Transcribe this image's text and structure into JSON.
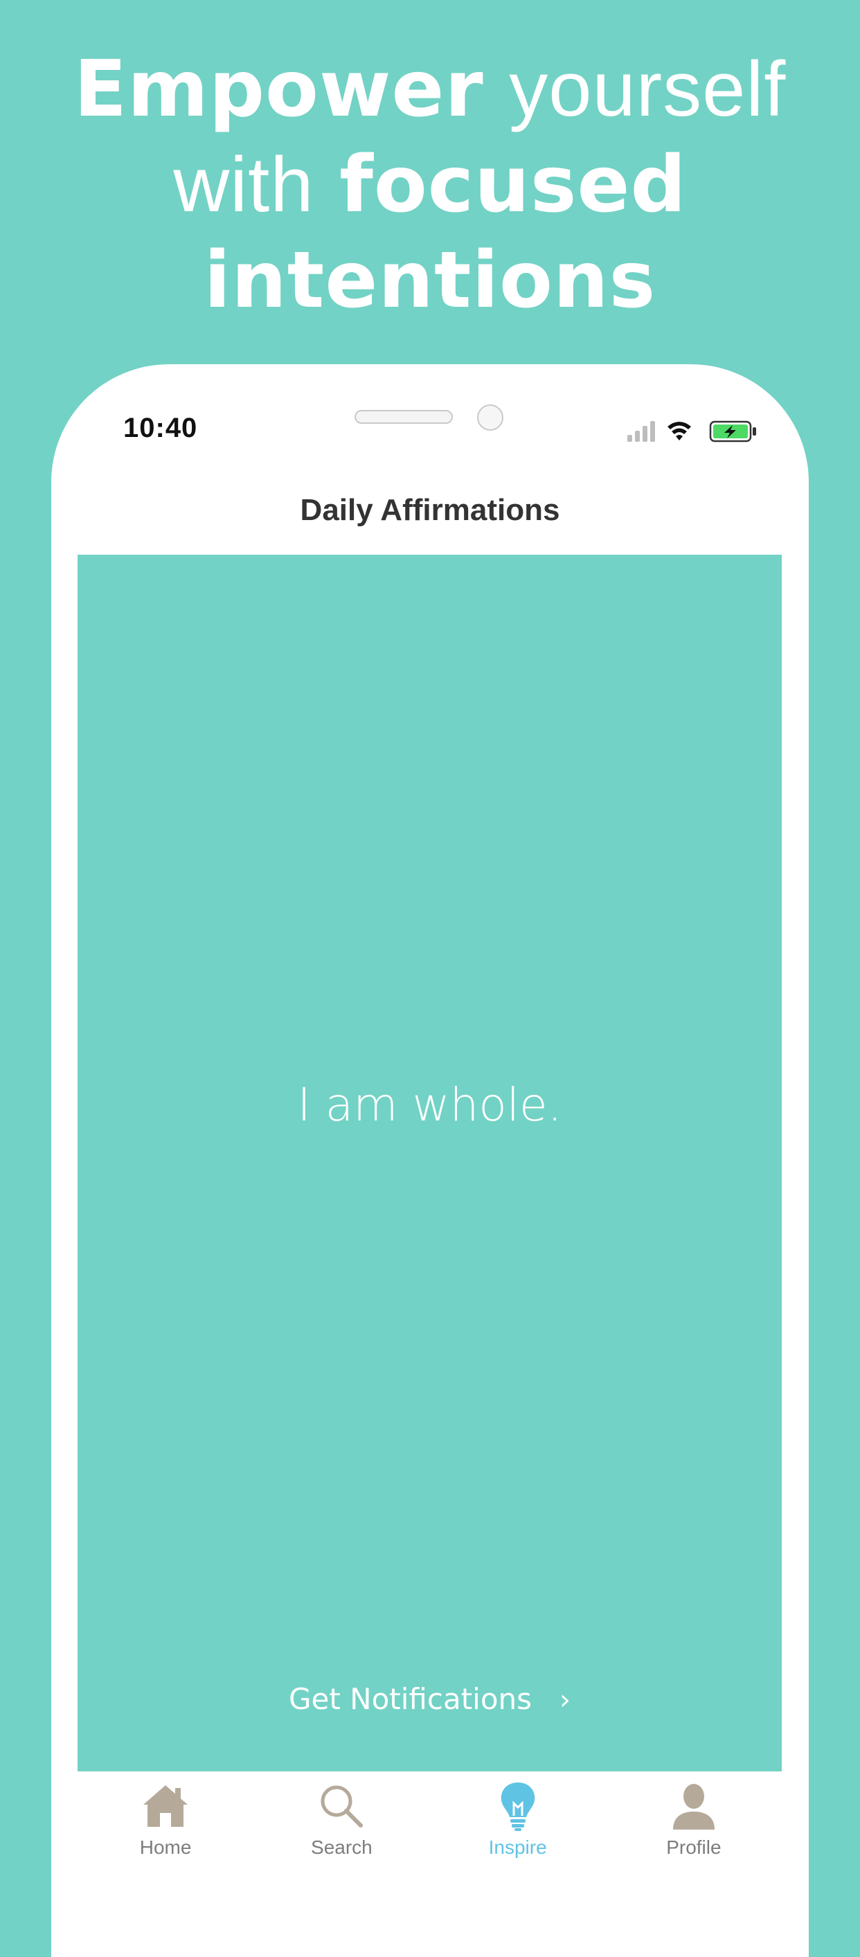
{
  "headline": {
    "line1_bold": "Empower",
    "line1_light": "yourself",
    "line2_light": "with",
    "line2_bold": "focused",
    "line3_bold": "intentions"
  },
  "status_bar": {
    "time": "10:40"
  },
  "screen": {
    "title": "Daily Affirmations",
    "affirmation": "I am whole.",
    "notifications_label": "Get Notifications",
    "notifications_chevron": "›"
  },
  "tabs": [
    {
      "label": "Home",
      "icon": "home-icon",
      "active": false
    },
    {
      "label": "Search",
      "icon": "search-icon",
      "active": false
    },
    {
      "label": "Inspire",
      "icon": "lightbulb-icon",
      "active": true
    },
    {
      "label": "Profile",
      "icon": "person-icon",
      "active": false
    }
  ],
  "colors": {
    "background": "#72d2c5",
    "card": "#72d2c5",
    "tab_inactive": "#b5aa9a",
    "tab_active": "#5fc3e4",
    "battery": "#4cd964"
  }
}
